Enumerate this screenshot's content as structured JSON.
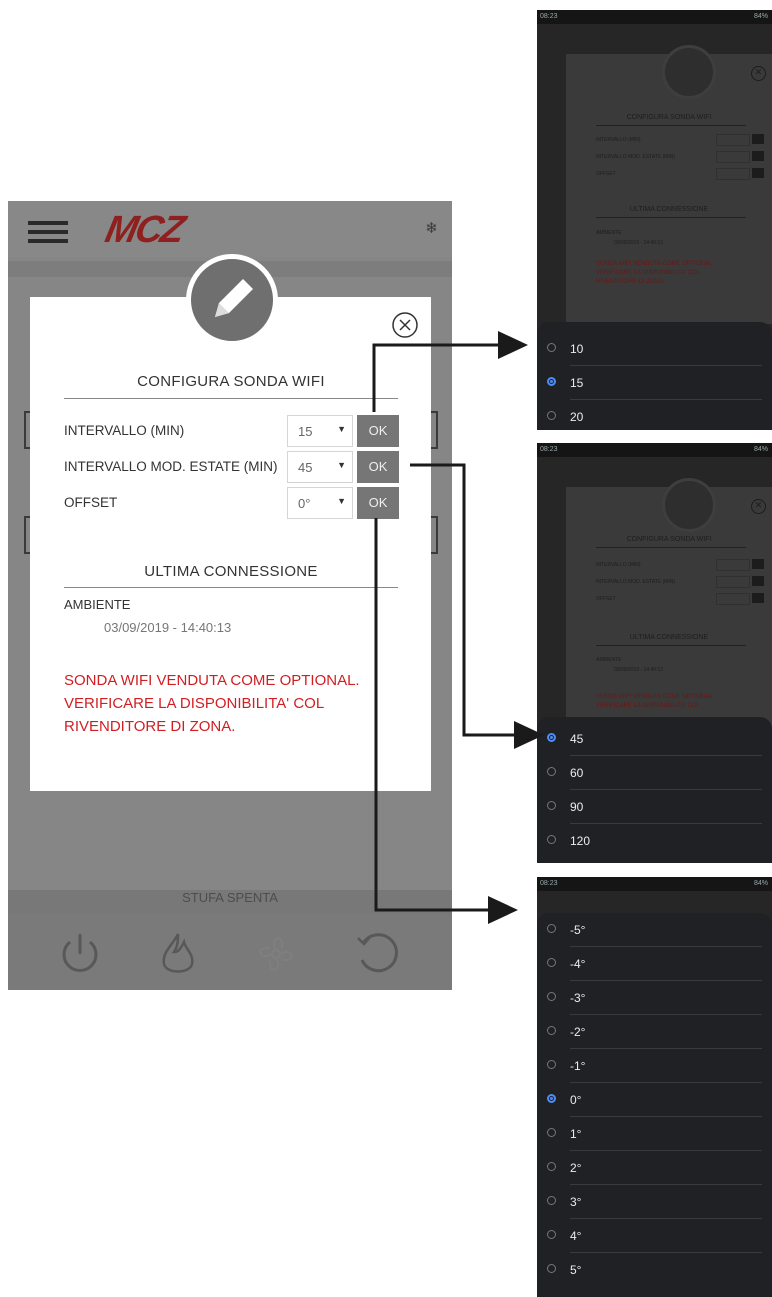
{
  "app": {
    "logo": "MCZ",
    "menu_icon": "hamburger-icon",
    "top_right_icon": "snowflake-icon",
    "status_text": "STUFA SPENTA",
    "bottom_icons": [
      "power-icon",
      "flame-icon",
      "fan-icon",
      "refresh-icon"
    ]
  },
  "dialog": {
    "header_icon": "pencil-icon",
    "close_icon": "close-icon",
    "section1_title": "CONFIGURA SONDA WIFI",
    "rows": [
      {
        "label": "INTERVALLO (MIN)",
        "value": "15",
        "ok": "OK"
      },
      {
        "label": "INTERVALLO MOD. ESTATE (MIN)",
        "value": "45",
        "ok": "OK"
      },
      {
        "label": "OFFSET",
        "value": "0°",
        "ok": "OK"
      }
    ],
    "section2_title": "ULTIMA CONNESSIONE",
    "ambient_label": "AMBIENTE",
    "ambient_datetime": "03/09/2019 - 14:40:13",
    "warning_lines": [
      "SONDA WIFI VENDUTA COME OPTIONAL.",
      "VERIFICARE LA DISPONIBILITA' COL",
      "RIVENDITORE DI ZONA."
    ]
  },
  "phones": {
    "statusbar_time": "08:23",
    "statusbar_right": "84%",
    "interval_options": [
      "10",
      "15",
      "20"
    ],
    "interval_selected": "15",
    "summer_options": [
      "45",
      "60",
      "90",
      "120"
    ],
    "summer_selected": "45",
    "offset_options": [
      "-5°",
      "-4°",
      "-3°",
      "-2°",
      "-1°",
      "0°",
      "1°",
      "2°",
      "3°",
      "4°",
      "5°"
    ],
    "offset_selected": "0°"
  },
  "colors": {
    "warning": "#d11e22",
    "radio_selected": "#4f8cf6",
    "logo": "#8e2020"
  }
}
